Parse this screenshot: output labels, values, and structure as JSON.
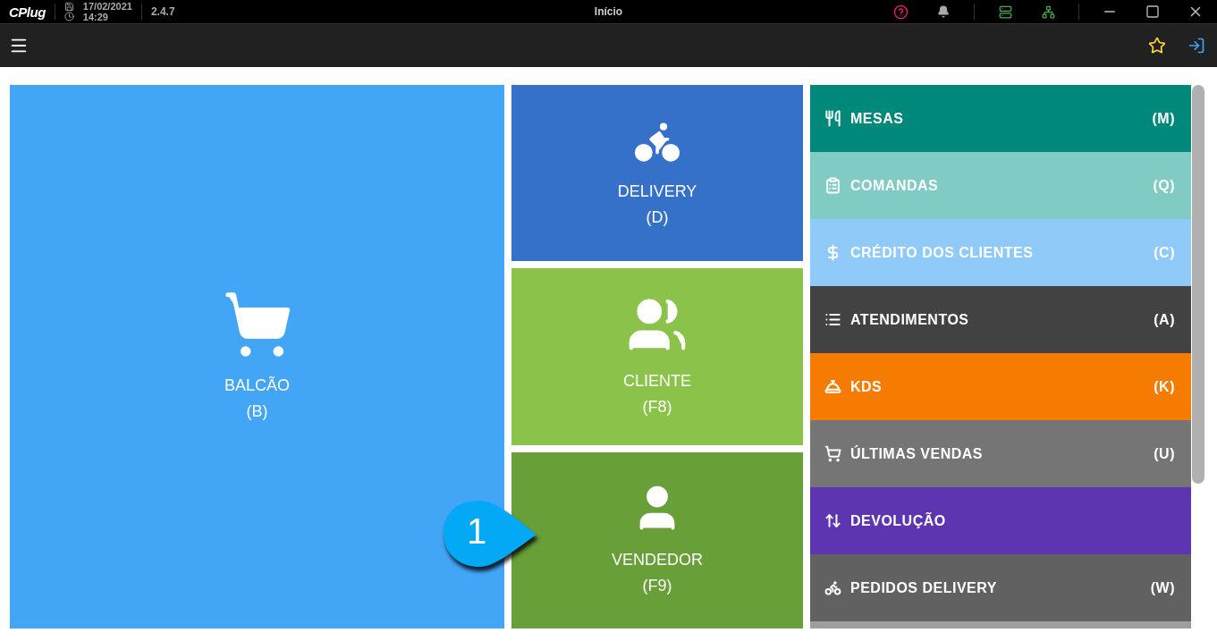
{
  "titlebar": {
    "logo": "CPlug",
    "date": "17/02/2021",
    "time": "14:29",
    "version": "2.4.7",
    "title": "Início"
  },
  "tiles": [
    {
      "label": "BALCÃO",
      "shortcut": "(B)",
      "color": "#42a5f5"
    },
    {
      "label": "DELIVERY",
      "shortcut": "(D)",
      "color": "#3570c9"
    },
    {
      "label": "CLIENTE",
      "shortcut": "(F8)",
      "color": "#8bc34a"
    },
    {
      "label": "VENDEDOR",
      "shortcut": "(F9)",
      "color": "#689f38"
    }
  ],
  "menu": [
    {
      "label": "MESAS",
      "shortcut": "(M)",
      "color": "#00897b"
    },
    {
      "label": "COMANDAS",
      "shortcut": "(Q)",
      "color": "#80cbc4"
    },
    {
      "label": "CRÉDITO DOS CLIENTES",
      "shortcut": "(C)",
      "color": "#90caf9"
    },
    {
      "label": "ATENDIMENTOS",
      "shortcut": "(A)",
      "color": "#424242"
    },
    {
      "label": "KDS",
      "shortcut": "(K)",
      "color": "#f57c00"
    },
    {
      "label": "ÚLTIMAS VENDAS",
      "shortcut": "(U)",
      "color": "#757575"
    },
    {
      "label": "DEVOLUÇÃO",
      "color": "#5e35b1"
    },
    {
      "label": "PEDIDOS DELIVERY",
      "shortcut": "(W)",
      "color": "#616161"
    }
  ],
  "callout": {
    "number": "1"
  }
}
